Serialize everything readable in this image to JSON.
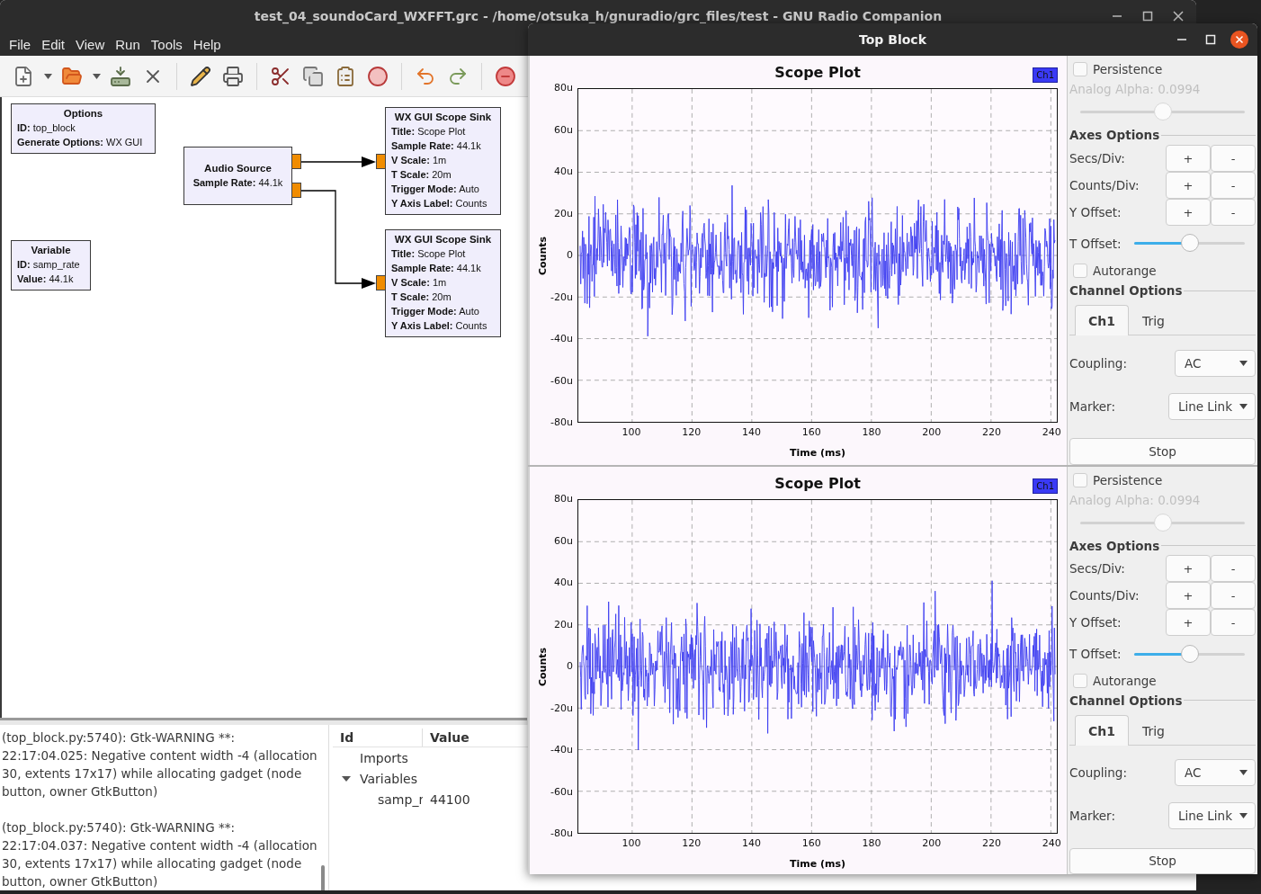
{
  "editor": {
    "title": "test_04_soundoCard_WXFFT.grc - /home/otsuka_h/gnuradio/grc_files/test - GNU Radio Companion",
    "menu": [
      "File",
      "Edit",
      "View",
      "Run",
      "Tools",
      "Help"
    ],
    "blocks": [
      {
        "title": "Options",
        "params": [
          {
            "name": "ID:",
            "value": "top_block"
          },
          {
            "name": "Generate Options:",
            "value": "WX GUI"
          }
        ]
      },
      {
        "title": "Audio Source",
        "params": [
          {
            "name": "Sample Rate:",
            "value": "44.1k"
          }
        ]
      },
      {
        "title": "WX GUI Scope Sink",
        "params": [
          {
            "name": "Title:",
            "value": "Scope Plot"
          },
          {
            "name": "Sample Rate:",
            "value": "44.1k"
          },
          {
            "name": "V Scale:",
            "value": "1m"
          },
          {
            "name": "T Scale:",
            "value": "20m"
          },
          {
            "name": "Trigger Mode:",
            "value": "Auto"
          },
          {
            "name": "Y Axis Label:",
            "value": "Counts"
          }
        ]
      },
      {
        "title": "Variable",
        "params": [
          {
            "name": "ID:",
            "value": "samp_rate"
          },
          {
            "name": "Value:",
            "value": "44.1k"
          }
        ]
      },
      {
        "title": "WX GUI Scope Sink",
        "params": [
          {
            "name": "Title:",
            "value": "Scope Plot"
          },
          {
            "name": "Sample Rate:",
            "value": "44.1k"
          },
          {
            "name": "V Scale:",
            "value": "1m"
          },
          {
            "name": "T Scale:",
            "value": "20m"
          },
          {
            "name": "Trigger Mode:",
            "value": "Auto"
          },
          {
            "name": "Y Axis Label:",
            "value": "Counts"
          }
        ]
      }
    ],
    "console": [
      "(top_block.py:5740): Gtk-WARNING **: 22:17:04.025: Negative content width -4 (allocation 30, extents 17x17) while allocating gadget (node button, owner GtkButton)",
      "(top_block.py:5740): Gtk-WARNING **: 22:17:04.037: Negative content width -4 (allocation 30, extents 17x17) while allocating gadget (node button, owner GtkButton)"
    ],
    "variables": {
      "columns": [
        "Id",
        "Value"
      ],
      "rows": [
        {
          "id": "Imports"
        },
        {
          "id": "Variables",
          "expanded": true,
          "children": [
            {
              "id": "samp_r",
              "value": "44100"
            }
          ]
        }
      ]
    }
  },
  "top_block": {
    "title": "Top Block",
    "panels": [
      {
        "plot": {
          "title": "Scope Plot",
          "channel": "Ch1",
          "ylabel": "Counts",
          "xlabel": "Time (ms)",
          "yticks": [
            "80u",
            "60u",
            "40u",
            "20u",
            "0",
            "-20u",
            "-40u",
            "-60u",
            "-80u"
          ],
          "xticks": [
            "100",
            "120",
            "140",
            "160",
            "180",
            "200",
            "220",
            "240"
          ]
        },
        "controls": {
          "persistence": {
            "label": "Persistence",
            "checked": false
          },
          "alpha": {
            "label": "Analog Alpha: 0.0994",
            "disabled": true,
            "level": 0.5
          },
          "axes_title": "Axes Options",
          "axes_rows": [
            {
              "label": "Secs/Div:",
              "plus": "+",
              "minus": "-"
            },
            {
              "label": "Counts/Div:",
              "plus": "+",
              "minus": "-"
            },
            {
              "label": "Y Offset:",
              "plus": "+",
              "minus": "-"
            }
          ],
          "t_offset": {
            "label": "T Offset:",
            "level": 0.5
          },
          "autorange": {
            "label": "Autorange",
            "checked": false
          },
          "channel_title": "Channel Options",
          "tabs": [
            {
              "label": "Ch1",
              "selected": true
            },
            {
              "label": "Trig",
              "selected": false
            }
          ],
          "fields": [
            {
              "label": "Coupling:",
              "value": "AC"
            },
            {
              "label": "Marker:",
              "value": "Line Link"
            }
          ],
          "stop": "Stop"
        }
      },
      {
        "plot": {
          "title": "Scope Plot",
          "channel": "Ch1",
          "ylabel": "Counts",
          "xlabel": "Time (ms)",
          "yticks": [
            "80u",
            "60u",
            "40u",
            "20u",
            "0",
            "-20u",
            "-40u",
            "-60u",
            "-80u"
          ],
          "xticks": [
            "100",
            "120",
            "140",
            "160",
            "180",
            "200",
            "220",
            "240"
          ]
        },
        "controls": {
          "persistence": {
            "label": "Persistence",
            "checked": false
          },
          "alpha": {
            "label": "Analog Alpha: 0.0994",
            "disabled": true,
            "level": 0.5
          },
          "axes_title": "Axes Options",
          "axes_rows": [
            {
              "label": "Secs/Div:",
              "plus": "+",
              "minus": "-"
            },
            {
              "label": "Counts/Div:",
              "plus": "+",
              "minus": "-"
            },
            {
              "label": "Y Offset:",
              "plus": "+",
              "minus": "-"
            }
          ],
          "t_offset": {
            "label": "T Offset:",
            "level": 0.5
          },
          "autorange": {
            "label": "Autorange",
            "checked": false
          },
          "channel_title": "Channel Options",
          "tabs": [
            {
              "label": "Ch1",
              "selected": true
            },
            {
              "label": "Trig",
              "selected": false
            }
          ],
          "fields": [
            {
              "label": "Coupling:",
              "value": "AC"
            },
            {
              "label": "Marker:",
              "value": "Line Link"
            }
          ],
          "stop": "Stop"
        }
      }
    ]
  }
}
